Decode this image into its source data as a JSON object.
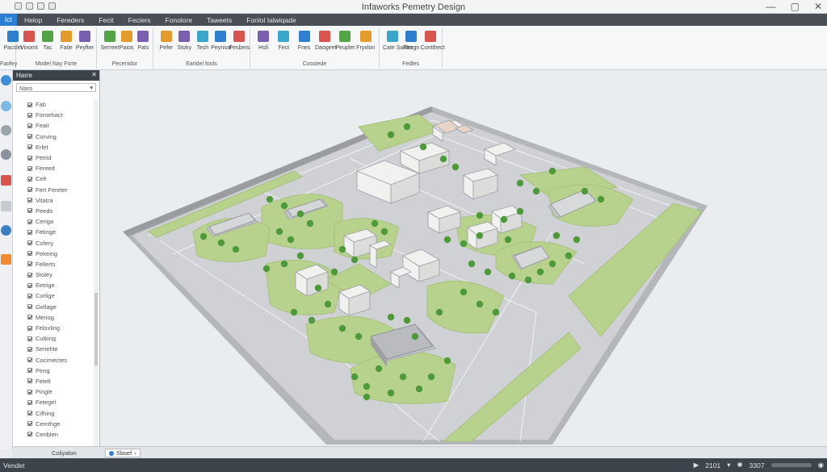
{
  "app": {
    "title": "Infaworks Pemetry Design",
    "window_controls": [
      "—",
      "▢",
      "✕"
    ]
  },
  "menu": [
    "Ict",
    "Helop",
    "Fereders",
    "Fecit",
    "Feciers",
    "Fonolore",
    "Taweets",
    "Fonlol Ialwiqade"
  ],
  "ribbon": {
    "groups": [
      {
        "label": "Faofey",
        "buttons": [
          {
            "label": "Pacslet",
            "icon": "layers-icon"
          }
        ]
      },
      {
        "label": "Model Nay  Fsrte",
        "buttons": [
          {
            "label": "Vinomt",
            "icon": "document-icon"
          },
          {
            "label": "Tac",
            "icon": "flag-icon"
          },
          {
            "label": "Fatie",
            "icon": "paint-icon"
          },
          {
            "label": "Peyfter",
            "icon": "pencil-icon"
          }
        ]
      },
      {
        "label": "Pecenidor",
        "buttons": [
          {
            "label": "Serreet",
            "icon": "edit-icon"
          },
          {
            "label": "Paios",
            "icon": "brush-icon"
          },
          {
            "label": "Pats",
            "icon": "page-icon"
          }
        ]
      },
      {
        "label": "Earldel fools",
        "buttons": [
          {
            "label": "Pefer",
            "icon": "table-icon"
          },
          {
            "label": "Stoky",
            "icon": "folder-icon"
          },
          {
            "label": "Tesh",
            "icon": "eraser-icon"
          },
          {
            "label": "Peyniod",
            "icon": "clipboard-icon"
          },
          {
            "label": "Pesbers",
            "icon": "window-icon"
          }
        ]
      },
      {
        "label": "Cosstede",
        "buttons": [
          {
            "label": "Hsfi",
            "icon": "grid-icon"
          },
          {
            "label": "Fect",
            "icon": "chrome-icon"
          },
          {
            "label": "Fnes",
            "icon": "globe-icon"
          },
          {
            "label": "Daogeet",
            "icon": "cursor-icon"
          },
          {
            "label": "Peuplet",
            "icon": "chart-icon"
          },
          {
            "label": "Fryxlon",
            "icon": "gear-icon"
          }
        ]
      },
      {
        "label": "Fedles",
        "buttons": [
          {
            "label": "Cate Salder",
            "icon": "info-icon"
          },
          {
            "label": "Feogn",
            "icon": "help-icon"
          },
          {
            "label": "Contthect",
            "icon": "check-icon"
          }
        ]
      }
    ]
  },
  "panel": {
    "title": "Harre",
    "search_placeholder": "Naro",
    "items": [
      "Fab",
      "Fornehact",
      "Feait",
      "Corving",
      "Erlet",
      "Petrid",
      "Fereed",
      "Celt",
      "Fert Fereter",
      "Vitatra",
      "Peeds",
      "Ceriga",
      "Fetinge",
      "Cofery",
      "Pekeing",
      "Fellerts",
      "Stoley",
      "Eetrige",
      "Corlige",
      "Gellage",
      "Meriog",
      "Feloxling",
      "Culking",
      "Seriehle",
      "Cocimectes",
      "Peng",
      "Fetelt",
      "Pingle",
      "Fetegel",
      "Cifhing",
      "Cemthge",
      "Cenblen"
    ],
    "footer": "Coliyalon"
  },
  "view": {
    "tab": "Sbsef"
  },
  "status": {
    "left": "Vendet",
    "coord1": "2101",
    "coord2": "3307"
  },
  "colors": {
    "accent": "#2a7fd4",
    "grass": "#b9d38f",
    "road": "#c7c9cc"
  }
}
